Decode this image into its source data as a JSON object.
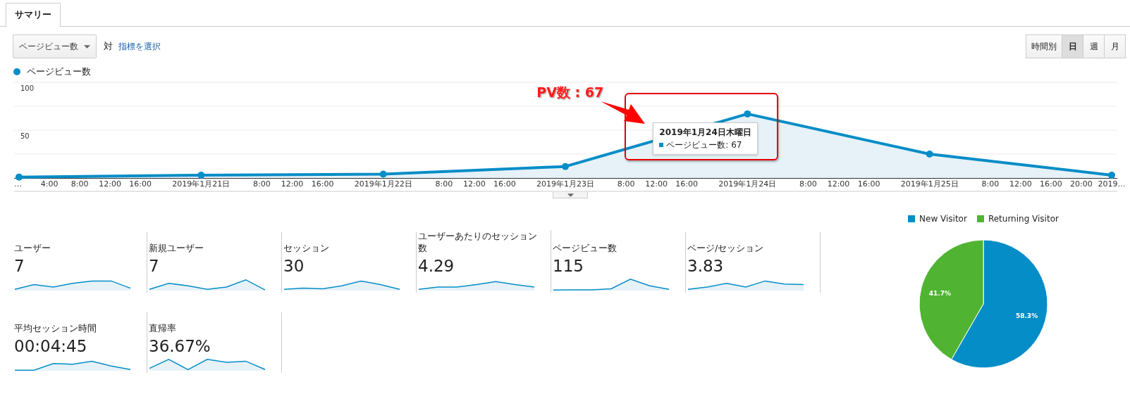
{
  "tabs": [
    {
      "label": "サマリー",
      "selected": true
    }
  ],
  "toolbar": {
    "metric_dropdown": {
      "value": "ページビュー数"
    },
    "versus_label": "対",
    "select_metric_link": "指標を選択",
    "periods": [
      {
        "label": "時間別",
        "selected": false
      },
      {
        "label": "日",
        "selected": true
      },
      {
        "label": "週",
        "selected": false
      },
      {
        "label": "月",
        "selected": false
      }
    ]
  },
  "line_chart": {
    "chart_data": {
      "type": "area",
      "series": [
        {
          "name": "ページビュー数",
          "color": "#058dc7",
          "values": [
            1,
            3,
            4,
            12,
            67,
            25,
            3
          ]
        }
      ],
      "categories": [
        "…",
        "2019年1月21日",
        "2019年1月22日",
        "2019年1月23日",
        "2019年1月24日",
        "2019年1月25日",
        "2019…"
      ],
      "ylim": [
        0,
        100
      ],
      "yticks": [
        50,
        100
      ],
      "annotations": [
        "PV数 : 67"
      ]
    },
    "time_ticks": [
      [
        "4:00",
        "8:00",
        "12:00",
        "16:00"
      ],
      [
        "8:00",
        "12:00",
        "16:00"
      ],
      [
        "8:00",
        "12:00",
        "16:00"
      ],
      [
        "8:00",
        "12:00",
        "16:00"
      ],
      [
        "8:00",
        "12:00",
        "16:00"
      ],
      [
        "8:00",
        "12:00",
        "16:00",
        "20:00"
      ]
    ],
    "tooltip": {
      "title": "2019年1月24日木曜日",
      "label": "ページビュー数: 67"
    }
  },
  "metrics": [
    {
      "label": "ユーザー",
      "value": "7"
    },
    {
      "label": "新規ユーザー",
      "value": "7"
    },
    {
      "label": "セッション",
      "value": "30"
    },
    {
      "label": "ユーザーあたりのセッション数",
      "value": "4.29"
    },
    {
      "label": "ページビュー数",
      "value": "115"
    },
    {
      "label": "ページ/セッション",
      "value": "3.83"
    },
    {
      "label": "平均セッション時間",
      "value": "00:04:45"
    },
    {
      "label": "直帰率",
      "value": "36.67%"
    }
  ],
  "pie_chart": {
    "legend": [
      {
        "color": "#058dc7"
      },
      {
        "color": "#50b432"
      }
    ],
    "chart_data": {
      "type": "pie",
      "categories": [
        "New Visitor",
        "Returning Visitor"
      ],
      "values": [
        58.3,
        41.7
      ],
      "value_labels": [
        "58.3%",
        "41.7%"
      ]
    }
  }
}
